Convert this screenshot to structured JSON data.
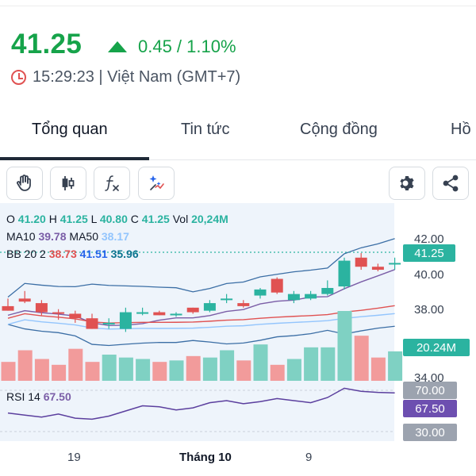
{
  "quote": {
    "price": "41.25",
    "change": "0.45 / 1.10%",
    "time": "15:29:23 | Việt Nam (GMT+7)"
  },
  "tabs": [
    {
      "label": "Tổng quan",
      "active": true
    },
    {
      "label": "Tin tức"
    },
    {
      "label": "Cộng đồng"
    },
    {
      "label": "Hồ"
    }
  ],
  "toolbar": {
    "left": [
      "hand-icon",
      "candlestick-icon",
      "function-icon",
      "ai-magic-icon"
    ],
    "right": [
      "gear-icon",
      "share-icon"
    ]
  },
  "legend": {
    "ohlc": {
      "o_label": "O",
      "o": "41.20",
      "h_label": "H",
      "h": "41.25",
      "l_label": "L",
      "l": "40.80",
      "c_label": "C",
      "c": "41.25",
      "vol_label": "Vol",
      "vol": "20,24M"
    },
    "ma": {
      "ma10_label": "MA10",
      "ma10": "39.78",
      "ma50_label": "MA50",
      "ma50": "38.17"
    },
    "bb": {
      "label": "BB 20 2",
      "upper": "38.73",
      "mid": "41.51",
      "lower": "35.96"
    },
    "rsi": {
      "label": "RSI 14",
      "value": "67.50"
    }
  },
  "axis": {
    "price_ticks": [
      "42.00",
      "40.00",
      "38.00",
      "34.00"
    ],
    "price_badge": "41.25",
    "volume_badge": "20.24M",
    "rsi_upper": "70.00",
    "rsi_value": "67.50",
    "rsi_lower": "30.00"
  },
  "x_axis": {
    "labels": [
      "19",
      "Tháng 10",
      "9"
    ]
  },
  "colors": {
    "up": "#2bb3a0",
    "down": "#e05252",
    "accent_green": "#16a34a",
    "bb_line": "#3b6ea5",
    "ma_purple": "#7b5ea7",
    "ma_lightblue": "#93c5fd",
    "rsi_line": "#5b3f9e"
  },
  "chart_data": {
    "type": "candlestick",
    "candles": [
      {
        "o": 38.4,
        "h": 38.9,
        "l": 38.1,
        "c": 38.1
      },
      {
        "o": 38.9,
        "h": 39.4,
        "l": 38.6,
        "c": 38.7
      },
      {
        "o": 38.6,
        "h": 38.8,
        "l": 37.8,
        "c": 38.0
      },
      {
        "o": 38.0,
        "h": 38.2,
        "l": 37.5,
        "c": 37.9
      },
      {
        "o": 37.9,
        "h": 38.1,
        "l": 37.3,
        "c": 37.6
      },
      {
        "o": 37.6,
        "h": 37.9,
        "l": 36.9,
        "c": 36.9
      },
      {
        "o": 37.2,
        "h": 37.6,
        "l": 36.9,
        "c": 37.3
      },
      {
        "o": 36.9,
        "h": 38.3,
        "l": 36.7,
        "c": 38.0
      },
      {
        "o": 37.9,
        "h": 38.3,
        "l": 37.8,
        "c": 38.0
      },
      {
        "o": 38.0,
        "h": 38.1,
        "l": 37.8,
        "c": 37.8
      },
      {
        "o": 37.9,
        "h": 38.0,
        "l": 37.7,
        "c": 37.9
      },
      {
        "o": 38.3,
        "h": 38.3,
        "l": 37.9,
        "c": 38.0
      },
      {
        "o": 38.1,
        "h": 38.8,
        "l": 38.0,
        "c": 38.6
      },
      {
        "o": 38.9,
        "h": 39.2,
        "l": 38.6,
        "c": 38.9
      },
      {
        "o": 38.6,
        "h": 38.8,
        "l": 38.3,
        "c": 38.4
      },
      {
        "o": 39.1,
        "h": 39.6,
        "l": 38.9,
        "c": 39.5
      },
      {
        "o": 40.2,
        "h": 40.3,
        "l": 39.2,
        "c": 39.3
      },
      {
        "o": 38.8,
        "h": 39.4,
        "l": 38.6,
        "c": 39.2
      },
      {
        "o": 38.9,
        "h": 39.4,
        "l": 38.8,
        "c": 39.2
      },
      {
        "o": 39.2,
        "h": 40.1,
        "l": 39.1,
        "c": 39.6
      },
      {
        "o": 39.7,
        "h": 41.6,
        "l": 39.5,
        "c": 41.4
      },
      {
        "o": 41.6,
        "h": 41.9,
        "l": 40.8,
        "c": 41.0
      },
      {
        "o": 41.0,
        "h": 41.2,
        "l": 40.7,
        "c": 40.8
      },
      {
        "o": 41.2,
        "h": 41.6,
        "l": 40.8,
        "c": 41.25
      }
    ],
    "volumes_m": [
      13,
      21,
      15,
      11,
      22,
      13,
      18,
      16,
      15,
      13,
      14,
      17,
      16,
      21,
      14,
      25,
      11,
      15,
      23,
      23,
      48,
      31,
      16,
      20.24
    ],
    "ylim": [
      34,
      43
    ],
    "rsi_lim": [
      30,
      70
    ]
  }
}
